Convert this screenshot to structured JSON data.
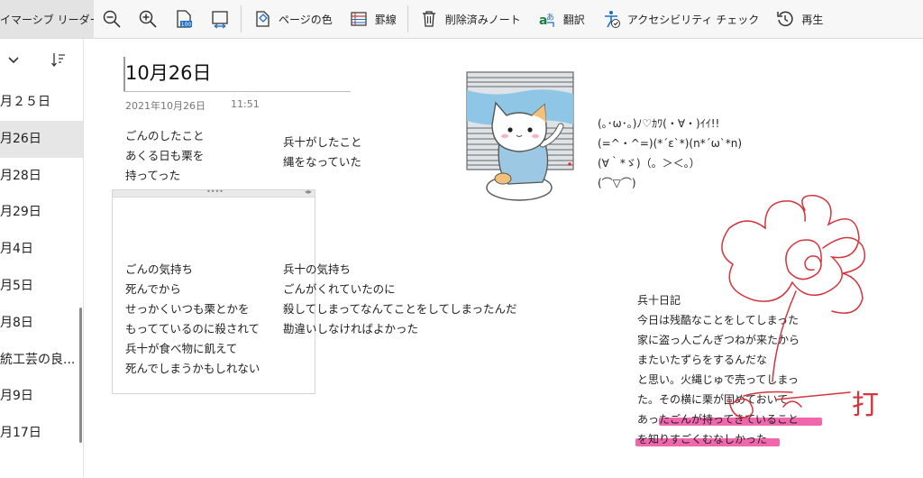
{
  "toolbar": {
    "first_label": "イマーシブ リーダー",
    "page_color": "ページの色",
    "rule_lines": "罫線",
    "deleted_notes": "削除済みノート",
    "translate": "翻訳",
    "accessibility": "アクセシビリティ チェック",
    "replay": "再生"
  },
  "sidebar": {
    "items": [
      {
        "label": "月２５日"
      },
      {
        "label": "月26日"
      },
      {
        "label": "月28日"
      },
      {
        "label": "月29日"
      },
      {
        "label": "月4日"
      },
      {
        "label": "月5日"
      },
      {
        "label": "月8日"
      },
      {
        "label": "統工芸の良..."
      },
      {
        "label": "月9日"
      },
      {
        "label": "月17日"
      }
    ],
    "selected_index": 1
  },
  "page": {
    "title": "10月26日",
    "date": "2021年10月26日",
    "time": "11:51"
  },
  "notes": {
    "gon_did": [
      "ごんのしたこと",
      "あくる日も栗を",
      "持ってった"
    ],
    "hyoju_did": [
      "兵十がしたこと",
      "縄をなっていた"
    ],
    "gon_feeling": [
      "ごんの気持ち",
      "死んでから",
      "せっかくいつも栗とかを",
      "もってているのに殺されて",
      "兵十が食べ物に飢えて",
      "死んでしまうかもしれない"
    ],
    "hyoju_feeling": [
      "兵十の気持ち",
      "ごんがくれていたのに",
      "殺してしまってなんてことをしてしまったんだ",
      "勘違いしなければよかった"
    ],
    "emoticons": [
      "(｡･ω･｡)ﾉ♡ｶﾜ(・∀・)ｲｲ!!",
      "(=^・^=)(*´ε`*)(n*´ω`*n)",
      "(∀｀*ゞ)（。＞＜。）",
      "(⌒▽⌒)"
    ],
    "diary": [
      "兵十日記",
      "今日は残酷なことをしてしまった",
      "家に盗っ人ごんぎつねが来たから",
      "またいたずらをするんだな",
      "と思い。火縄じゅで売ってしまっ",
      "た。その横に栗が固めておいて",
      "あったごんが持ってきていること",
      "を知りすごくむなしかった"
    ]
  },
  "ink": {
    "handwriting": "打",
    "color": "#d4343c",
    "highlight_color": "#ef5aa7"
  }
}
